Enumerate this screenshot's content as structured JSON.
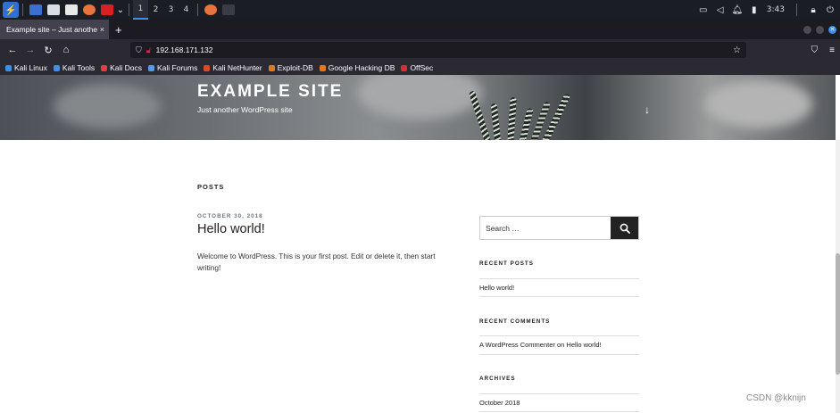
{
  "taskbar": {
    "workspaces": [
      "1",
      "2",
      "3",
      "4"
    ],
    "clock": "3:43"
  },
  "browser": {
    "tab_title": "Example site – Just another W",
    "tab_close": "×",
    "new_tab": "+",
    "url": "192.168.171.132",
    "bookmarks": [
      {
        "label": "Kali Linux",
        "color": "#3d8fe8"
      },
      {
        "label": "Kali Tools",
        "color": "#4a8de0"
      },
      {
        "label": "Kali Docs",
        "color": "#e04040"
      },
      {
        "label": "Kali Forums",
        "color": "#5a9be8"
      },
      {
        "label": "Kali NetHunter",
        "color": "#d84a2a"
      },
      {
        "label": "Exploit-DB",
        "color": "#e07a20"
      },
      {
        "label": "Google Hacking DB",
        "color": "#e07a20"
      },
      {
        "label": "OffSec",
        "color": "#d83030"
      }
    ]
  },
  "site": {
    "title": "EXAMPLE SITE",
    "description": "Just another WordPress site",
    "posts_heading": "POSTS",
    "post": {
      "date": "OCTOBER 30, 2018",
      "title": "Hello world!",
      "body": "Welcome to WordPress. This is your first post. Edit or delete it, then start writing!"
    },
    "sidebar": {
      "search_placeholder": "Search …",
      "recent_posts_title": "RECENT POSTS",
      "recent_posts": [
        "Hello world!"
      ],
      "recent_comments_title": "RECENT COMMENTS",
      "recent_comments": [
        "A WordPress Commenter on Hello world!"
      ],
      "archives_title": "ARCHIVES",
      "archives": [
        "October 2018"
      ]
    }
  },
  "watermark": "CSDN @kknijn"
}
